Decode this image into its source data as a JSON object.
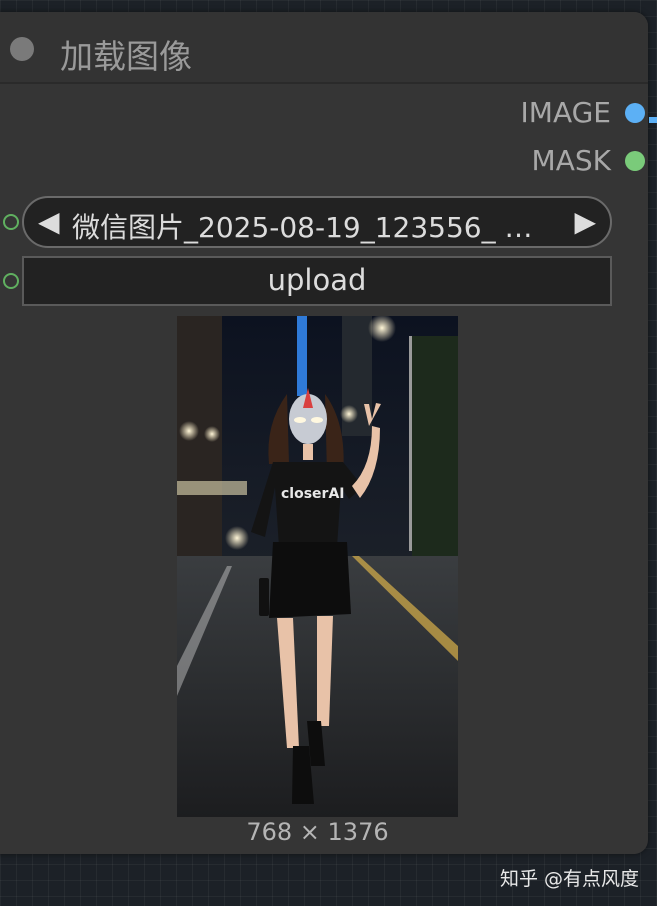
{
  "node": {
    "title": "加载图像",
    "outputs": [
      {
        "label": "IMAGE",
        "color": "#5cb0f5"
      },
      {
        "label": "MASK",
        "color": "#7acb7a"
      }
    ],
    "image_select": {
      "value": "微信图片_2025-08-19_123556_ …",
      "prev_arrow": "◀",
      "next_arrow": "▶"
    },
    "upload_label": "upload",
    "preview": {
      "dimensions": "768 × 1376",
      "shirt_text": "closerAI"
    }
  },
  "watermark": "知乎 @有点风度"
}
